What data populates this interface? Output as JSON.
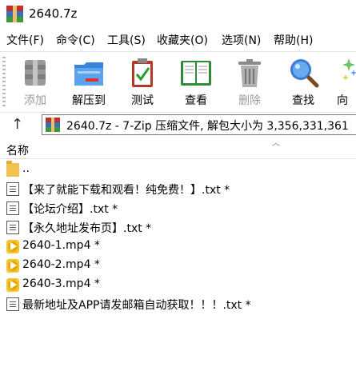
{
  "window": {
    "title": "2640.7z"
  },
  "menu": [
    {
      "label": "文件(F)"
    },
    {
      "label": "命令(C)"
    },
    {
      "label": "工具(S)"
    },
    {
      "label": "收藏夹(O)"
    },
    {
      "label": "选项(N)"
    },
    {
      "label": "帮助(H)"
    }
  ],
  "toolbar": [
    {
      "label": "添加",
      "icon": "add-icon",
      "disabled": true
    },
    {
      "label": "解压到",
      "icon": "extract-folder-icon",
      "disabled": false
    },
    {
      "label": "测试",
      "icon": "test-clipboard-icon",
      "disabled": false
    },
    {
      "label": "查看",
      "icon": "view-book-icon",
      "disabled": false
    },
    {
      "label": "删除",
      "icon": "trash-icon",
      "disabled": true
    },
    {
      "label": "查找",
      "icon": "magnifier-icon",
      "disabled": false
    },
    {
      "label": "向",
      "icon": "wizard-icon",
      "disabled": false
    }
  ],
  "address": {
    "text": "2640.7z - 7-Zip 压缩文件, 解包大小为 3,356,331,361"
  },
  "list": {
    "column_name": "名称",
    "rows": [
      {
        "type": "folder",
        "name": ".."
      },
      {
        "type": "text",
        "name": "【来了就能下载和观看！纯免费！】.txt *"
      },
      {
        "type": "text",
        "name": "【论坛介绍】.txt *"
      },
      {
        "type": "text",
        "name": "【永久地址发布页】.txt *"
      },
      {
        "type": "video",
        "name": "2640-1.mp4 *"
      },
      {
        "type": "video",
        "name": "2640-2.mp4 *"
      },
      {
        "type": "video",
        "name": "2640-3.mp4 *"
      },
      {
        "type": "text",
        "name": "最新地址及APP请发邮箱自动获取！！！.txt *"
      }
    ]
  }
}
